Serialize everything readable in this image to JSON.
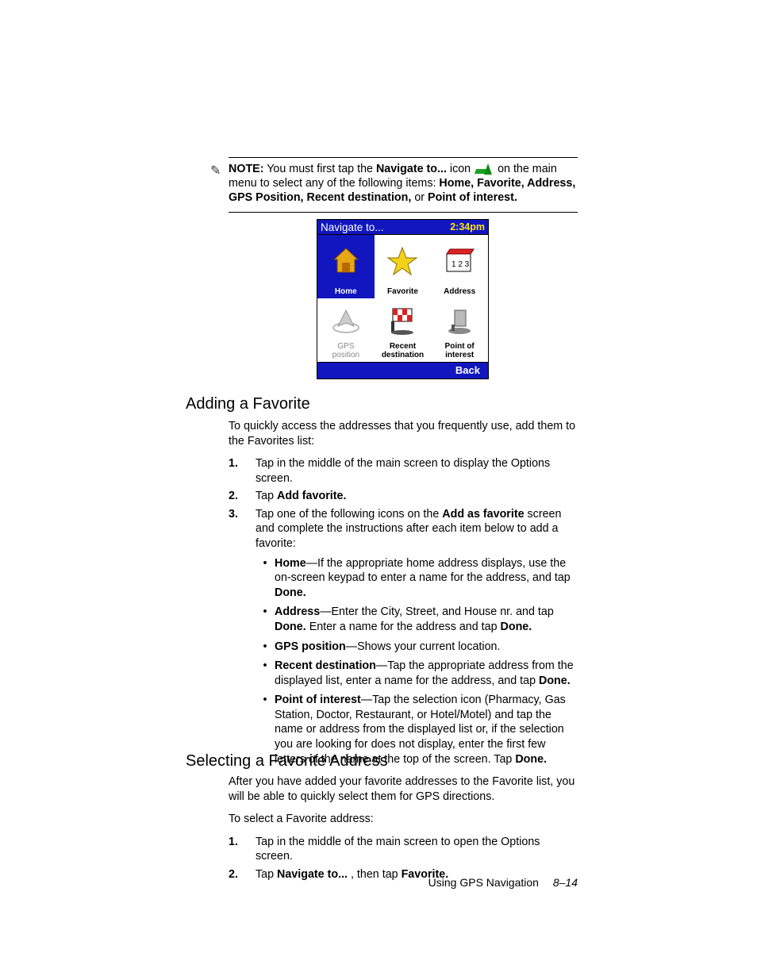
{
  "note": {
    "label": "NOTE:",
    "pre": " You must first tap the ",
    "cmd": "Navigate to...",
    "mid1": " icon ",
    "mid2": " on the main menu to select any of the following items: ",
    "bold_items": "Home, Favorite, Address, GPS Position, Recent destination,",
    "or": " or ",
    "last_bold": "Point of interest."
  },
  "device": {
    "title": "Navigate to...",
    "time": "2:34pm",
    "cells": {
      "home": "Home",
      "favorite": "Favorite",
      "address": "Address",
      "gps_l1": "GPS",
      "gps_l2": "position",
      "recent_l1": "Recent",
      "recent_l2": "destination",
      "poi_l1": "Point of",
      "poi_l2": "interest"
    },
    "back": "Back"
  },
  "section_add": "Adding a Favorite",
  "add_intro": "To quickly access the addresses that you frequently use, add them to the Favorites list:",
  "add_steps": {
    "s1": "Tap in the middle of the main screen to display the Options screen.",
    "s2_pre": "Tap ",
    "s2_bold": "Add favorite.",
    "s3_pre": "Tap one of the following icons on the ",
    "s3_bold": "Add as favorite",
    "s3_post": " screen and complete the instructions after each item below to add a favorite:"
  },
  "bullets": {
    "home_b": "Home",
    "home_t": "—If the appropriate home address displays, use the on-screen keypad to enter a name for the address, and tap ",
    "home_done": "Done.",
    "addr_b": "Address",
    "addr_t1": "—Enter the City, Street, and House nr. and tap ",
    "addr_done1": "Done.",
    "addr_t2": " Enter a name for the address and tap ",
    "addr_done2": "Done.",
    "gps_b": "GPS position",
    "gps_t": "—Shows your current location.",
    "rec_b": "Recent destination",
    "rec_t": "—Tap the appropriate address from the displayed list, enter a name for the address, and tap ",
    "rec_done": "Done.",
    "poi_b": "Point of interest",
    "poi_t": "—Tap the selection icon (Pharmacy, Gas Station, Doctor, Restaurant, or Hotel/Motel) and tap the name or address from the displayed list or, if the selection you are looking for does not display, enter the first few letters of the name at the top of the screen. Tap ",
    "poi_done": "Done."
  },
  "section_sel": "Selecting a Favorite Address",
  "sel_p1": "After you have added your favorite addresses to the Favorite list, you will be able to quickly select them for GPS directions.",
  "sel_p2": "To select a Favorite address:",
  "sel_steps": {
    "s1": "Tap in the middle of the main screen to open the Options screen.",
    "s2_pre": "Tap ",
    "s2_b1": "Navigate to...",
    "s2_mid": " , then tap ",
    "s2_b2": "Favorite."
  },
  "footer": {
    "title": "Using GPS Navigation",
    "page": "8–14"
  },
  "numbers": {
    "n1": "1.",
    "n2": "2.",
    "n3": "3."
  },
  "bullet_char": "•"
}
